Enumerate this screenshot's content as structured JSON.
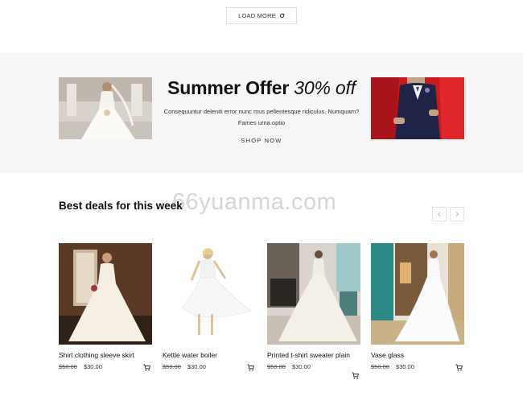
{
  "load_more": {
    "label": "LOAD MORE",
    "icon": "refresh-icon"
  },
  "offer": {
    "title_main": "Summer Offer",
    "title_pct": "30% off",
    "description": "Consequuntur deleniti error nunc mus pellentesque ridiculus. Numquam? Fames urna optio",
    "cta": "SHOP NOW"
  },
  "watermark": "66yuanma.com",
  "deals": {
    "heading": "Best deals for this week",
    "products": [
      {
        "name": "Shirt clothing sleeve skirt",
        "old_price": "$50.00",
        "price": "$30.00"
      },
      {
        "name": "Kettle water boiler",
        "old_price": "$50.00",
        "price": "$30.00"
      },
      {
        "name": "Printed t-shirt sweater plain",
        "old_price": "$50.00",
        "price": "$30.00"
      },
      {
        "name": "Vase glass",
        "old_price": "$50.00",
        "price": "$30.00"
      }
    ]
  },
  "colors": {
    "band": "#f6f6f6",
    "text": "#111111",
    "red": "#c81a1f",
    "teal": "#2b8a86"
  }
}
